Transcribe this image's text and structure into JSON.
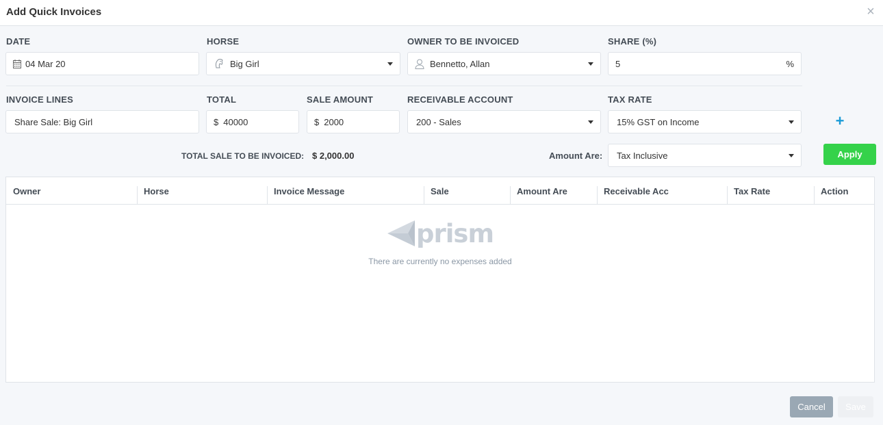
{
  "modal": {
    "title": "Add Quick Invoices",
    "close_icon": "×"
  },
  "form": {
    "date": {
      "label": "DATE",
      "value": "04 Mar 20",
      "icon": "calendar-icon"
    },
    "horse": {
      "label": "HORSE",
      "value": "Big Girl",
      "icon": "horse-head-icon"
    },
    "owner": {
      "label": "OWNER TO BE INVOICED",
      "value": "Bennetto, Allan",
      "icon": "user-icon"
    },
    "share": {
      "label": "SHARE (%)",
      "value": "5",
      "suffix": "%"
    },
    "invoice_lines": {
      "label": "INVOICE LINES",
      "value": "Share Sale: Big Girl"
    },
    "total": {
      "label": "TOTAL",
      "prefix": "$",
      "value": "40000"
    },
    "sale_amount": {
      "label": "SALE AMOUNT",
      "prefix": "$",
      "value": "2000"
    },
    "receivable_account": {
      "label": "RECEIVABLE ACCOUNT",
      "value": "200 - Sales"
    },
    "tax_rate": {
      "label": "TAX RATE",
      "value": "15% GST on Income"
    },
    "add_line_icon": "+"
  },
  "summary": {
    "total_label": "TOTAL SALE TO BE INVOICED:",
    "total_value": "$ 2,000.00",
    "amount_are_label": "Amount Are:",
    "amount_are_value": "Tax Inclusive",
    "apply_label": "Apply"
  },
  "table": {
    "columns": [
      "Owner",
      "Horse",
      "Invoice Message",
      "Sale",
      "Amount Are",
      "Receivable Acc",
      "Tax Rate",
      "Action"
    ],
    "empty_logo_text": "prism",
    "empty_message": "There are currently no expenses added"
  },
  "footer": {
    "cancel_label": "Cancel",
    "save_label": "Save"
  },
  "colors": {
    "accent_blue": "#1a9bd7",
    "apply_green": "#35d24a",
    "cancel_gray": "#9aa8b4"
  }
}
